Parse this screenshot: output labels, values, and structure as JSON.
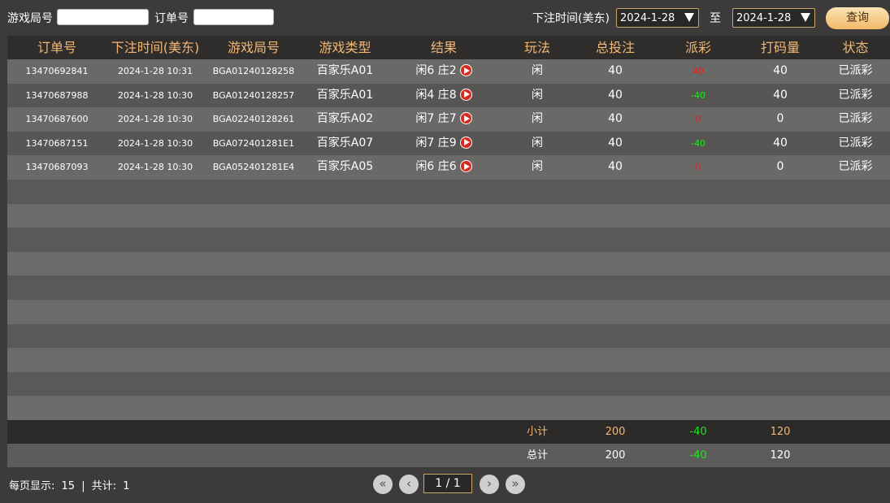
{
  "filters": {
    "game_no_label": "游戏局号",
    "order_no_label": "订单号",
    "bet_time_label": "下注时间(美东)",
    "date_from": "2024-1-28",
    "to_label": "至",
    "date_to": "2024-1-28",
    "query_label": "查询"
  },
  "table": {
    "headers": [
      "订单号",
      "下注时间(美东)",
      "游戏局号",
      "游戏类型",
      "结果",
      "玩法",
      "总投注",
      "派彩",
      "打码量",
      "状态"
    ],
    "rows": [
      {
        "order": "13470692841",
        "time": "2024-1-28 10:31",
        "game_no": "BGA01240128258",
        "game_type": "百家乐A01",
        "result": "闲6 庄2",
        "play": "闲",
        "bet": "40",
        "payout": "40",
        "payout_color": "red",
        "turnover": "40",
        "status": "已派彩"
      },
      {
        "order": "13470687988",
        "time": "2024-1-28 10:30",
        "game_no": "BGA01240128257",
        "game_type": "百家乐A01",
        "result": "闲4 庄8",
        "play": "闲",
        "bet": "40",
        "payout": "-40",
        "payout_color": "green",
        "turnover": "40",
        "status": "已派彩"
      },
      {
        "order": "13470687600",
        "time": "2024-1-28 10:30",
        "game_no": "BGA02240128261",
        "game_type": "百家乐A02",
        "result": "闲7 庄7",
        "play": "闲",
        "bet": "40",
        "payout": "0",
        "payout_color": "red",
        "turnover": "0",
        "status": "已派彩"
      },
      {
        "order": "13470687151",
        "time": "2024-1-28 10:30",
        "game_no": "BGA072401281E1",
        "game_type": "百家乐A07",
        "result": "闲7 庄9",
        "play": "闲",
        "bet": "40",
        "payout": "-40",
        "payout_color": "green",
        "turnover": "40",
        "status": "已派彩"
      },
      {
        "order": "13470687093",
        "time": "2024-1-28 10:30",
        "game_no": "BGA052401281E4",
        "game_type": "百家乐A05",
        "result": "闲6 庄6",
        "play": "闲",
        "bet": "40",
        "payout": "0",
        "payout_color": "red",
        "turnover": "0",
        "status": "已派彩"
      }
    ],
    "empty_rows": 10
  },
  "summary": {
    "subtotal": {
      "label": "小计",
      "bet": "200",
      "payout": "-40",
      "turnover": "120"
    },
    "total": {
      "label": "总计",
      "bet": "200",
      "payout": "-40",
      "turnover": "120"
    }
  },
  "footer": {
    "per_page_label": "每页显示:",
    "per_page": "15",
    "sep": "|",
    "total_label": "共计:",
    "total": "1"
  },
  "pagination": {
    "page_text": "1 / 1"
  },
  "colors": {
    "header_text": "#f1b875",
    "negative": "#1ee61e",
    "positive": "#e02020",
    "accent": "#c9a46a"
  },
  "icons": [
    "play-icon",
    "first-page-icon",
    "prev-page-icon",
    "next-page-icon",
    "last-page-icon",
    "dropdown-arrow-icon"
  ]
}
